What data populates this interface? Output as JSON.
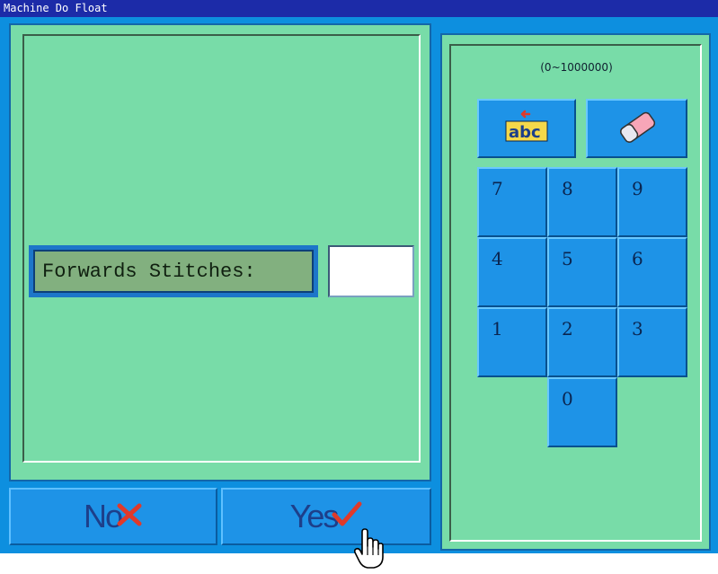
{
  "window": {
    "title": "Machine Do Float"
  },
  "form": {
    "field_label": "Forwards Stitches:",
    "field_value": ""
  },
  "keypad": {
    "range": "(0~1000000)",
    "backspace_icon": "abc",
    "keys": [
      "7",
      "8",
      "9",
      "4",
      "5",
      "6",
      "1",
      "2",
      "3",
      "0"
    ]
  },
  "buttons": {
    "no_label": "No",
    "yes_label": "Yes"
  },
  "colors": {
    "background": "#0d8fdf",
    "panel": "#78dca8",
    "key": "#1e93e7",
    "title_bar": "#1c2ba8",
    "accent_red": "#e03a2a"
  }
}
